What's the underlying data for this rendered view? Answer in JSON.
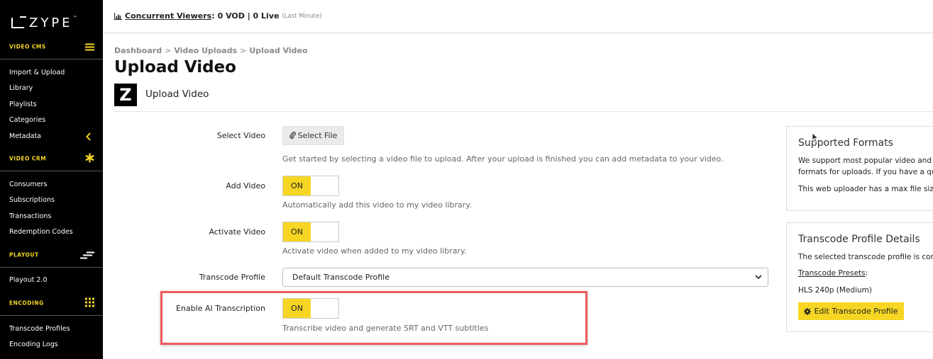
{
  "sidebar": {
    "brand": "ZYPE",
    "brand_tm": "™",
    "sections": [
      {
        "label": "VIDEO CMS",
        "icon": "menu-icon",
        "items": [
          "Import & Upload",
          "Library",
          "Playlists",
          "Categories",
          "Metadata"
        ]
      },
      {
        "label": "VIDEO CRM",
        "icon": "asterisk-icon",
        "items": [
          "Consumers",
          "Subscriptions",
          "Transactions",
          "Redemption Codes"
        ]
      },
      {
        "label": "PLAYOUT",
        "icon": "playout-lines-icon",
        "items": [
          "Playout 2.0"
        ]
      },
      {
        "label": "ENCODING",
        "icon": "grid-icon",
        "items": [
          "Transcode Profiles",
          "Encoding Logs"
        ]
      }
    ],
    "accent": "#f6d623"
  },
  "topbar": {
    "concurrent_label": "Concurrent Viewers",
    "concurrent_value": "0 VOD | 0 Live",
    "concurrent_note": "(Last Minute)"
  },
  "breadcrumb": [
    "Dashboard",
    "Video Uploads",
    "Upload Video"
  ],
  "page_title": "Upload Video",
  "app_logo_letter": "Z",
  "sub_title": "Upload Video",
  "form": {
    "select_video": {
      "label": "Select Video",
      "button": "Select File",
      "help": "Get started by selecting a video file to upload. After your upload is finished you can add metadata to your video."
    },
    "add_video": {
      "label": "Add Video",
      "toggle": "ON",
      "help": "Automatically add this video to my video library."
    },
    "activate_video": {
      "label": "Activate Video",
      "toggle": "ON",
      "help": "Activate video when added to my video library."
    },
    "transcode_profile": {
      "label": "Transcode Profile",
      "value": "Default Transcode Profile"
    },
    "ai_transcription": {
      "label": "Enable AI Transcription",
      "toggle": "ON",
      "help": "Transcribe video and generate SRT and VTT subtitles"
    }
  },
  "panels": {
    "supported": {
      "title": "Supported Formats",
      "line1": "We support most popular video and",
      "line2": "formats for uploads. If you have a qu",
      "line3": "This web uploader has a max file size"
    },
    "transcode": {
      "title": "Transcode Profile Details",
      "line1": "The selected transcode profile is con",
      "presets_label": "Transcode Presets",
      "presets_colon": ":",
      "preset_value": "HLS 240p (Medium)",
      "edit_button": "Edit Transcode Profile"
    }
  },
  "colors": {
    "toggle_on": "#f6d623",
    "highlight": "#ef5b5b",
    "sidebar_bg": "#000000"
  }
}
